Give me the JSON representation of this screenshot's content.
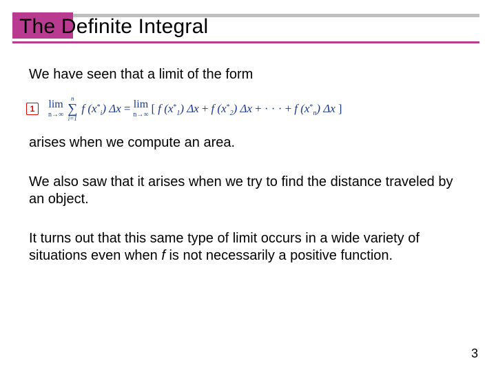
{
  "title": "The Definite Integral",
  "paragraphs": {
    "p1": "We have seen that a limit of the form",
    "p2": "arises when we compute an area.",
    "p3": "We also saw that it arises when we try to find the distance traveled by an object.",
    "p4_a": "It turns out that this same type of limit occurs in a wide variety of situations even when ",
    "p4_f": "f",
    "p4_b": " is not necessarily a positive function."
  },
  "equation": {
    "badge": "1",
    "lim": "lim",
    "limsub": "n→∞",
    "sum_top": "n",
    "sigma": "∑",
    "sum_bot": "i=1",
    "lhs_term": "f (x",
    "lhs_sub": "i",
    "lhs_post": ") Δx",
    "eq": " = ",
    "open": "[",
    "t1": "f (x",
    "s1": "1",
    "tpost": ") Δx",
    "plus": " + ",
    "t2": "f (x",
    "s2": "2",
    "dots": " + · · · + ",
    "tn": "f (x",
    "sn": "n",
    "close": "]",
    "star": "*"
  },
  "page_number": "3"
}
